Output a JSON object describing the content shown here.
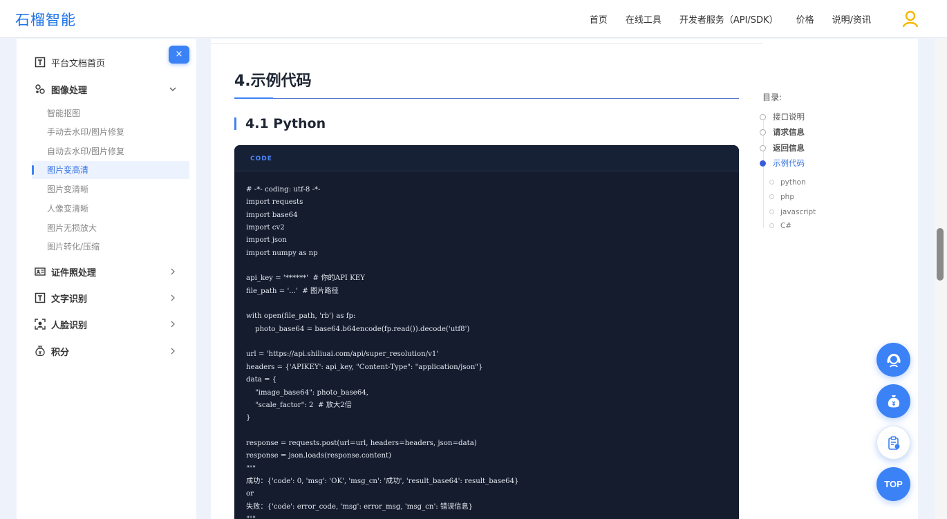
{
  "header": {
    "logo": "石榴智能",
    "nav": [
      "首页",
      "在线工具",
      "开发者服务（API/SDK）",
      "价格",
      "说明/资讯"
    ]
  },
  "sidebar": {
    "close_label": "×",
    "home": "平台文档首页",
    "groups": [
      {
        "label": "图像处理",
        "expanded": true
      },
      {
        "label": "证件照处理",
        "expanded": false
      },
      {
        "label": "文字识别",
        "expanded": false
      },
      {
        "label": "人脸识别",
        "expanded": false
      },
      {
        "label": "积分",
        "expanded": false
      }
    ],
    "image_items": [
      "智能抠图",
      "手动去水印/图片修复",
      "自动去水印/图片修复",
      "图片变高清",
      "图片变清晰",
      "人像变清晰",
      "图片无损放大",
      "图片转化/压缩"
    ],
    "active_item": "图片变高清"
  },
  "main": {
    "h1": "4.示例代码",
    "h2": "4.1 Python",
    "code_header": "CODE",
    "code_lines": [
      "# -*- coding: utf-8 -*-",
      "import requests",
      "import base64",
      "import cv2",
      "import json",
      "import numpy as np",
      "",
      "api_key = '******'  # 你的API KEY",
      "file_path = '...'  # 图片路径",
      "",
      "with open(file_path, 'rb') as fp:",
      "    photo_base64 = base64.b64encode(fp.read()).decode('utf8')",
      "",
      "url = 'https://api.shiliuai.com/api/super_resolution/v1'",
      "headers = {'APIKEY': api_key, \"Content-Type\": \"application/json\"}",
      "data = {",
      "    \"image_base64\": photo_base64,",
      "    \"scale_factor\": 2  # 放大2倍",
      "}",
      "",
      "response = requests.post(url=url, headers=headers, json=data)",
      "response = json.loads(response.content)",
      "\"\"\"",
      "成功：{'code': 0, 'msg': 'OK', 'msg_cn': '成功', 'result_base64': result_base64}",
      "or",
      "失败：{'code': error_code, 'msg': error_msg, 'msg_cn': 错误信息}",
      "\"\"\""
    ]
  },
  "toc": {
    "title": "目录:",
    "items": [
      {
        "label": "接口说明",
        "bold": false,
        "active": false
      },
      {
        "label": "请求信息",
        "bold": true,
        "active": false
      },
      {
        "label": "返回信息",
        "bold": true,
        "active": false
      },
      {
        "label": "示例代码",
        "bold": false,
        "active": true
      }
    ],
    "sub_items": [
      "python",
      "php",
      "javascript",
      "C#"
    ]
  },
  "fab": {
    "top_label": "TOP"
  },
  "colors": {
    "accent": "#3b82f6",
    "code_bg": "#141c2e",
    "logo": "#1b72e8"
  }
}
